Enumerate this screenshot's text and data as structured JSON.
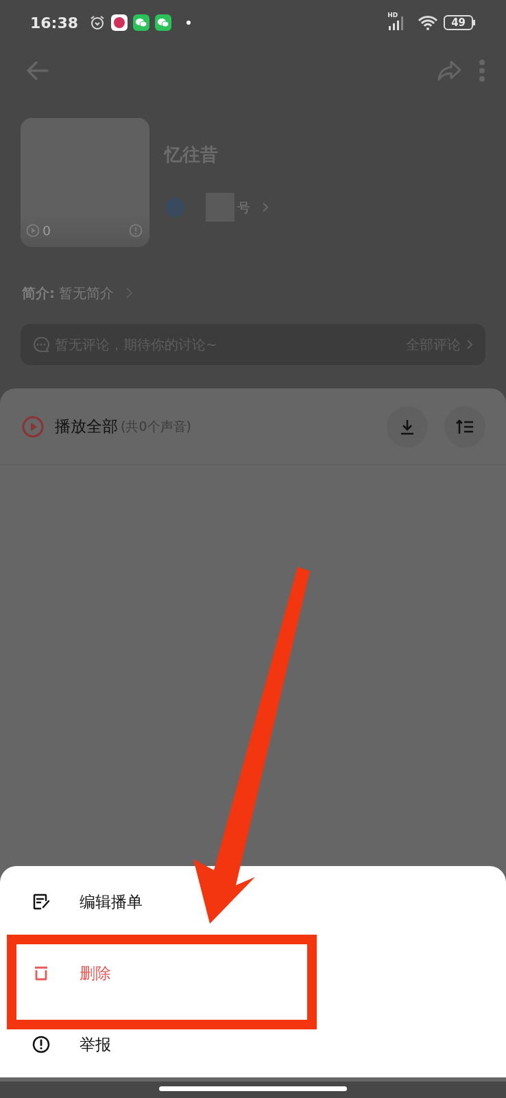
{
  "status_bar": {
    "time": "16:38",
    "network": "HD",
    "battery": "49"
  },
  "playlist": {
    "title": "忆往昔",
    "play_count": "0",
    "author_name": "号",
    "intro": "**简介:** 暂无简介"
  },
  "comments": {
    "placeholder_text": "暂无评论，期待你的讨论~",
    "all_link": "全部评论"
  },
  "play_all": {
    "label": "播放全部",
    "count": "(共0个声音)"
  },
  "menu": [
    {
      "kind": "edit",
      "label": "编辑播单",
      "highlighted": false
    },
    {
      "kind": "delete",
      "label": "删除",
      "highlighted": true
    },
    {
      "kind": "report",
      "label": "举报",
      "highlighted": false
    }
  ]
}
